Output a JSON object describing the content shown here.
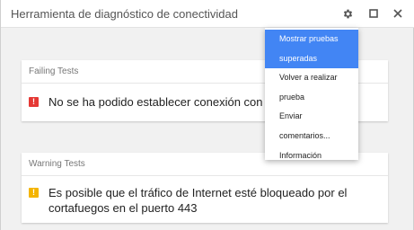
{
  "window": {
    "title": "Herramienta de diagnóstico de conectividad"
  },
  "titlebar_icons": [
    "gear-icon",
    "maximize-icon",
    "close-icon"
  ],
  "sections": [
    {
      "header": "Failing Tests",
      "status_icon": "error-icon",
      "status_color": "#e53935",
      "message": "No se ha podido establecer conexión con Ha"
    },
    {
      "header": "Warning Tests",
      "status_icon": "warning-icon",
      "status_color": "#f4b400",
      "message": "Es posible que el tráfico de Internet esté bloqueado por el cortafuegos en el puerto 443"
    }
  ],
  "menu": {
    "items": [
      {
        "lines": [
          "Mostrar pruebas",
          "superadas"
        ],
        "highlighted": true
      },
      {
        "lines": [
          "Volver a realizar",
          "prueba"
        ],
        "highlighted": false
      },
      {
        "lines": [
          "Enviar",
          "comentarios..."
        ],
        "highlighted": false
      },
      {
        "lines": [
          "Información"
        ],
        "highlighted": false
      }
    ],
    "highlight_color": "#4285f4"
  }
}
